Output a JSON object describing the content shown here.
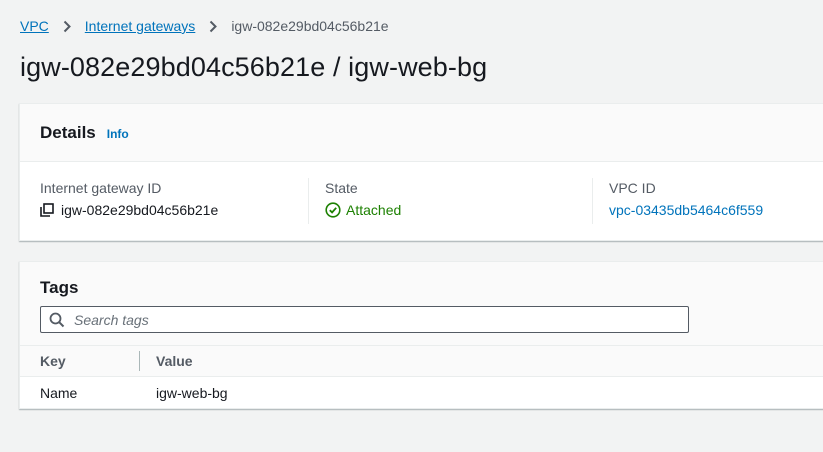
{
  "breadcrumb": {
    "items": [
      "VPC",
      "Internet gateways"
    ],
    "current": "igw-082e29bd04c56b21e"
  },
  "page": {
    "title": "igw-082e29bd04c56b21e / igw-web-bg"
  },
  "details": {
    "title": "Details",
    "info_label": "Info",
    "fields": [
      {
        "label": "Internet gateway ID",
        "value": "igw-082e29bd04c56b21e"
      },
      {
        "label": "State",
        "value": "Attached"
      },
      {
        "label": "VPC ID",
        "value": "vpc-03435db5464c6f559"
      }
    ]
  },
  "tags": {
    "title": "Tags",
    "search_placeholder": "Search tags",
    "columns": [
      "Key",
      "Value"
    ],
    "rows": [
      {
        "key": "Name",
        "value": "igw-web-bg"
      }
    ]
  },
  "colors": {
    "link": "#0073bb",
    "success": "#1d8102",
    "background": "#f2f3f3"
  },
  "icons": [
    "chevron-right-icon",
    "copy-icon",
    "status-success-icon",
    "search-icon"
  ]
}
